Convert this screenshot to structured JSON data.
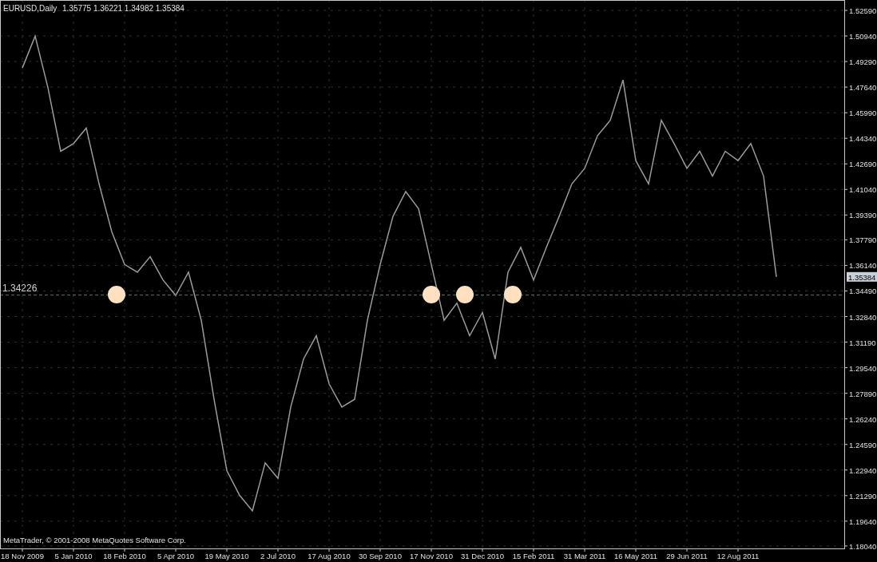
{
  "chart": {
    "symbol": "EURUSD,Daily",
    "ohlc": "1.35775 1.36221 1.34982 1.35384",
    "copyright": "MetaTrader, © 2001-2008 MetaQuotes Software Corp.",
    "chart_data": {
      "type": "line",
      "grid": true,
      "ylim": [
        1.1783,
        1.5326
      ],
      "categories": [
        "18 Nov 2009",
        null,
        null,
        null,
        "5 Jan 2010",
        null,
        null,
        null,
        "18 Feb 2010",
        null,
        null,
        null,
        "5 Apr 2010",
        null,
        null,
        null,
        "19 May 2010",
        null,
        null,
        null,
        "2 Jul 2010",
        null,
        null,
        null,
        "17 Aug 2010",
        null,
        null,
        null,
        "30 Sep 2010",
        null,
        null,
        null,
        "17 Nov 2010",
        null,
        null,
        null,
        "31 Dec 2010",
        null,
        null,
        null,
        "15 Feb 2011",
        null,
        null,
        null,
        "31 Mar 2011",
        null,
        null,
        null,
        "16 May 2011",
        null,
        null,
        null,
        "29 Jun 2011",
        null,
        null,
        null,
        "12 Aug 2011",
        null,
        null,
        null
      ],
      "series": [
        {
          "color": "#9a9a9a",
          "values": [
            1.4888,
            1.5094,
            1.476,
            1.435,
            1.44,
            1.45,
            1.414,
            1.383,
            1.362,
            1.357,
            1.367,
            1.352,
            1.342,
            1.357,
            1.326,
            1.275,
            1.229,
            1.213,
            1.203,
            1.234,
            1.224,
            1.27,
            1.301,
            1.316,
            1.285,
            1.27,
            1.275,
            1.326,
            1.362,
            1.393,
            1.409,
            1.398,
            1.362,
            1.326,
            1.337,
            1.316,
            1.331,
            1.301,
            1.357,
            1.373,
            1.352,
            1.373,
            1.393,
            1.414,
            1.424,
            1.445,
            1.455,
            1.481,
            1.429,
            1.414,
            1.455,
            1.44,
            1.424,
            1.435,
            1.419,
            1.435,
            1.429,
            1.44,
            1.419,
            1.354
          ]
        }
      ],
      "yticks": [
        {
          "value": 1.5259,
          "label": "1.52590"
        },
        {
          "value": 1.5094,
          "label": "1.50940"
        },
        {
          "value": 1.4929,
          "label": "1.49290"
        },
        {
          "value": 1.4764,
          "label": "1.47640"
        },
        {
          "value": 1.4599,
          "label": "1.45990"
        },
        {
          "value": 1.4434,
          "label": "1.44340"
        },
        {
          "value": 1.4269,
          "label": "1.42690"
        },
        {
          "value": 1.4104,
          "label": "1.41040"
        },
        {
          "value": 1.3939,
          "label": "1.39390"
        },
        {
          "value": 1.3779,
          "label": "1.37790"
        },
        {
          "value": 1.3614,
          "label": "1.36140"
        },
        {
          "value": 1.3449,
          "label": "1.34490"
        },
        {
          "value": 1.3284,
          "label": "1.32840"
        },
        {
          "value": 1.3119,
          "label": "1.31190"
        },
        {
          "value": 1.2954,
          "label": "1.29540"
        },
        {
          "value": 1.2789,
          "label": "1.27890"
        },
        {
          "value": 1.2624,
          "label": "1.26240"
        },
        {
          "value": 1.2459,
          "label": "1.24590"
        },
        {
          "value": 1.2294,
          "label": "1.22940"
        },
        {
          "value": 1.2129,
          "label": "1.21290"
        },
        {
          "value": 1.1964,
          "label": "1.19640"
        },
        {
          "value": 1.1804,
          "label": "1.18040"
        }
      ],
      "ref_lines": [
        {
          "axis": "y",
          "value": 1.34226,
          "label": "1.34226",
          "color": "#1fa01f"
        }
      ]
    },
    "current_price": {
      "label": "1.35384"
    }
  }
}
